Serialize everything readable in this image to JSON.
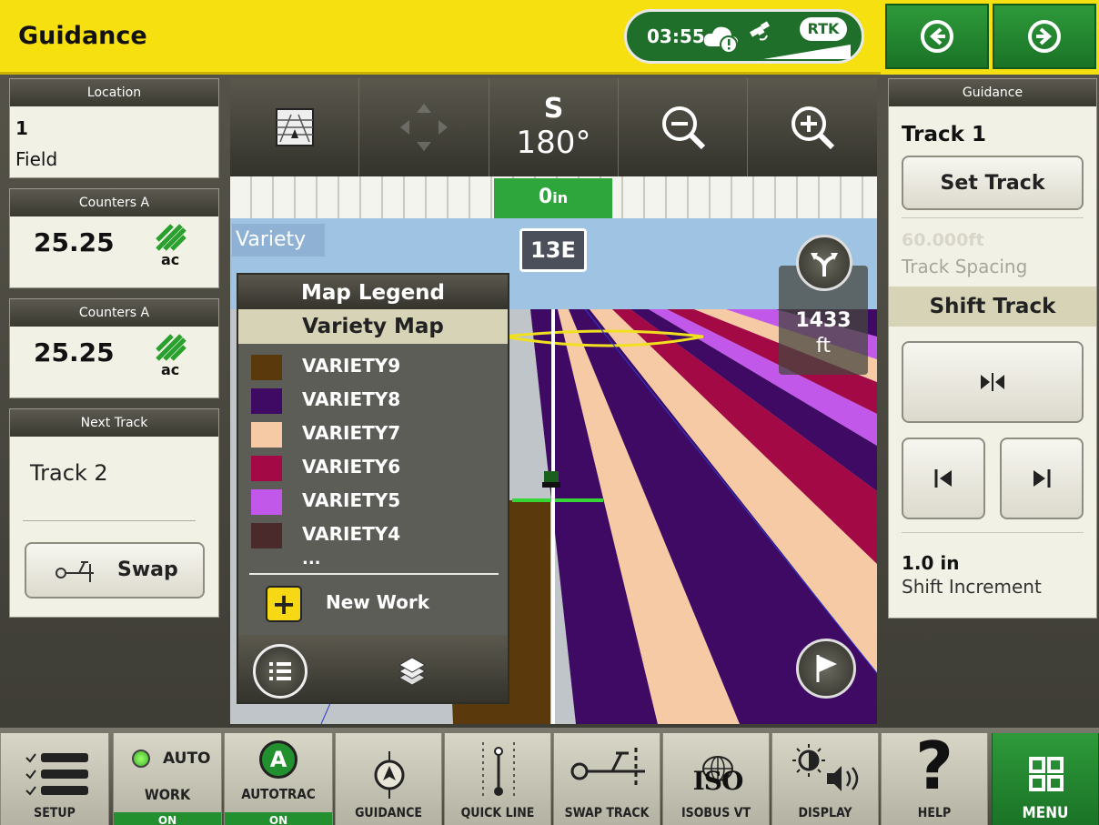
{
  "header": {
    "title": "Guidance",
    "time": "03:55",
    "rtk_badge": "RTK",
    "icons": [
      "cloud-warning-icon",
      "satellite-icon",
      "signal-strength-icon"
    ]
  },
  "nav": {
    "back_icon": "arrow-left-circle-icon",
    "forward_icon": "arrow-right-circle-icon"
  },
  "left": {
    "location": {
      "title": "Location",
      "line1": "1",
      "line2": "Field"
    },
    "counter1": {
      "title": "Counters A",
      "value": "25.25",
      "unit": "ac"
    },
    "counter2": {
      "title": "Counters A",
      "value": "25.25",
      "unit": "ac"
    },
    "next_track": {
      "title": "Next Track",
      "value": "Track 2",
      "swap_label": "Swap"
    }
  },
  "map": {
    "heading_letter": "S",
    "heading_degrees": "180°",
    "offset_value": "0",
    "offset_unit": "in",
    "layer_label": "Variety",
    "track_badge": "13E",
    "distance_value": "1433",
    "distance_unit": "ft",
    "legend": {
      "title": "Map Legend",
      "subtitle": "Variety Map",
      "items": [
        {
          "label": "VARIETY9",
          "color": "#5a3a0c"
        },
        {
          "label": "VARIETY8",
          "color": "#3f0a63"
        },
        {
          "label": "VARIETY7",
          "color": "#f7caa6"
        },
        {
          "label": "VARIETY6",
          "color": "#a30a45"
        },
        {
          "label": "VARIETY5",
          "color": "#c158ea"
        },
        {
          "label": "VARIETY4",
          "color": "#4a2a2a"
        }
      ],
      "more": "...",
      "new_work": "New Work"
    }
  },
  "right": {
    "title": "Guidance",
    "track": "Track 1",
    "set_track": "Set Track",
    "spacing_value": "60.000ft",
    "spacing_label": "Track Spacing",
    "shift_track": "Shift Track",
    "shift_value": "1.0 in",
    "shift_label": "Shift Increment"
  },
  "bottom": {
    "setup": "SETUP",
    "work_top": "AUTO",
    "work": "WORK",
    "work_on": "ON",
    "autotrac_letter": "A",
    "autotrac": "AUTOTRAC",
    "autotrac_on": "ON",
    "guidance": "GUIDANCE",
    "quick_line": "QUICK LINE",
    "swap_track": "SWAP TRACK",
    "isobus_icon_text": "ISO",
    "isobus": "ISOBUS VT",
    "display": "DISPLAY",
    "help_glyph": "?",
    "help": "HELP",
    "menu": "MENU"
  }
}
